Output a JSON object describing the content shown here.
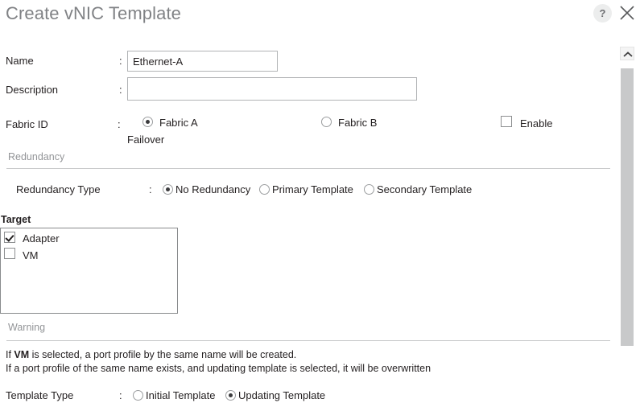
{
  "dialog": {
    "title": "Create vNIC Template",
    "help_label": "?",
    "close_label": "×"
  },
  "fields": {
    "name": {
      "label": "Name",
      "separator": ":",
      "value": "Ethernet-A",
      "placeholder": ""
    },
    "description": {
      "label": "Description",
      "separator": ":",
      "value": "",
      "placeholder": ""
    },
    "fabric_id": {
      "label": "Fabric ID",
      "separator": ":",
      "options": [
        {
          "label": "Fabric A",
          "selected": true
        },
        {
          "label": "Fabric B",
          "selected": false
        }
      ],
      "failover_label": "Failover",
      "enable_checkbox": {
        "label": "Enable",
        "checked": false
      }
    }
  },
  "redundancy": {
    "section_title": "Redundancy",
    "type": {
      "label": "Redundancy Type",
      "separator": ":",
      "options": [
        {
          "label": "No Redundancy",
          "selected": true
        },
        {
          "label": "Primary Template",
          "selected": false
        },
        {
          "label": "Secondary Template",
          "selected": false
        }
      ]
    }
  },
  "target": {
    "heading": "Target",
    "items": [
      {
        "label": "Adapter",
        "checked": true
      },
      {
        "label": "VM",
        "checked": false
      }
    ]
  },
  "warning": {
    "section_title": "Warning",
    "line1_prefix": "If ",
    "line1_bold": "VM",
    "line1_suffix": " is selected, a port profile by the same name will be created.",
    "line2": "If a port profile of the same name exists, and updating template is selected, it will be overwritten"
  },
  "template_type": {
    "label": "Template Type",
    "separator": ":",
    "options": [
      {
        "label": "Initial Template",
        "selected": false
      },
      {
        "label": "Updating Template",
        "selected": true
      }
    ]
  },
  "scrollbar": {
    "up_arrow": "scroll-up"
  }
}
